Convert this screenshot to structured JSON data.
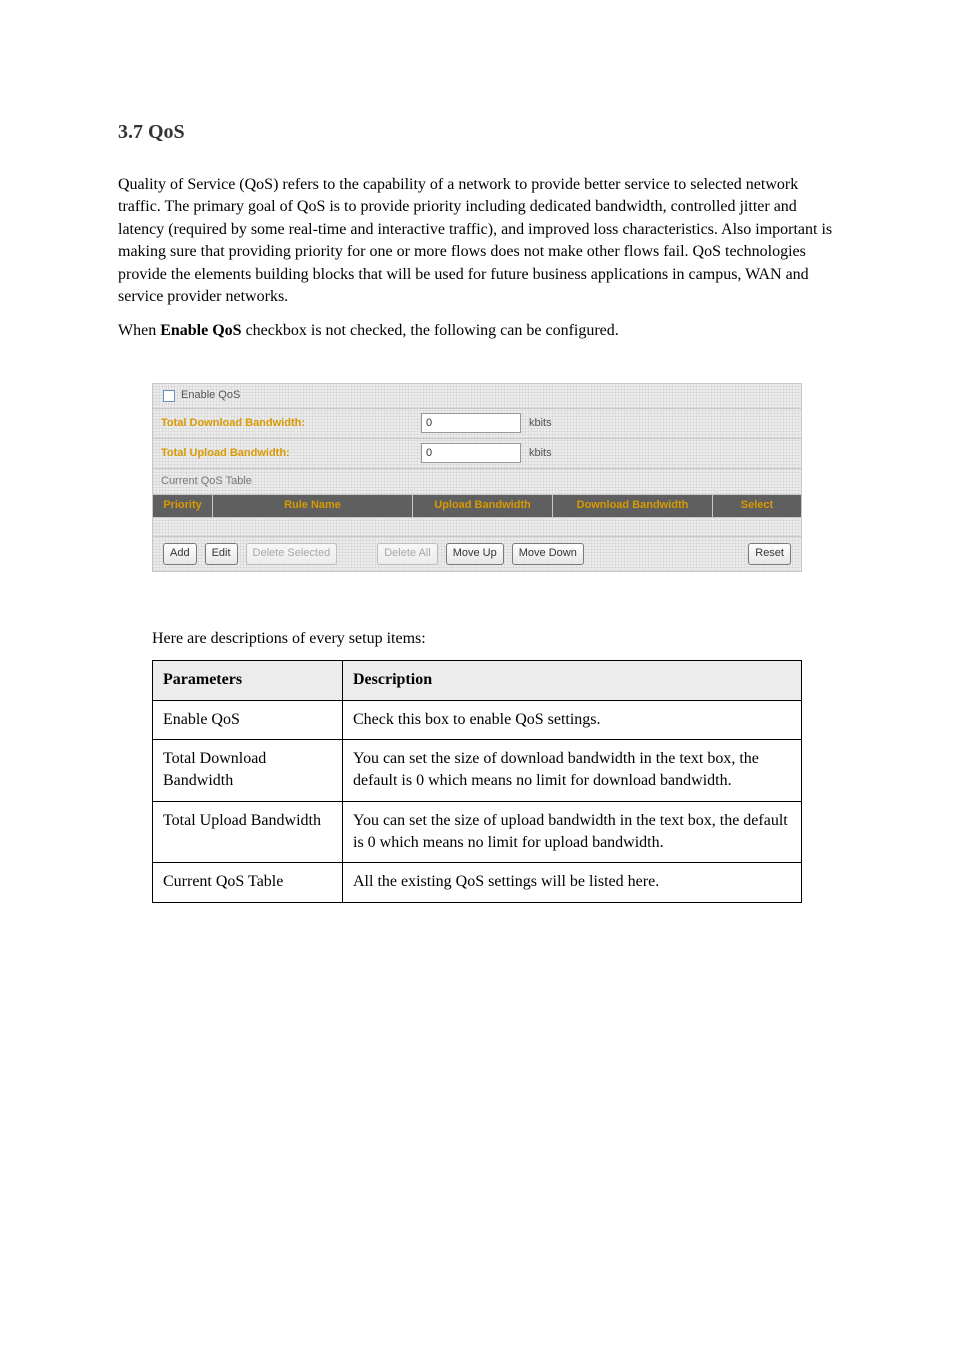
{
  "intro": {
    "title": "3.7 QoS",
    "paragraphs": [
      {
        "prefix": "Quality of Service (QoS) refers to the capability of a network to provide better service to selected network traffic.  The primary goal of QoS is to provide priority including dedicated bandwidth, controlled jitter and latency (required by some real-time and interactive traffic), and improved loss characteristics.  Also important is making sure that providing priority for one or more flows does not make other flows fail. QoS technologies provide the elements building blocks that will be used for future business applications in campus, WAN and service provider networks."
      },
      {
        "prefix": "When ",
        "bold": "Enable QoS",
        "suffix": " checkbox is not checked, the following can be configured."
      }
    ]
  },
  "panel": {
    "enable_label": "Enable QoS",
    "download": {
      "label": "Total Download Bandwidth:",
      "value": "0",
      "unit": "kbits"
    },
    "upload": {
      "label": "Total Upload Bandwidth:",
      "value": "0",
      "unit": "kbits"
    },
    "table_caption": "Current QoS Table",
    "headers": {
      "priority": "Priority",
      "rule": "Rule Name",
      "upload": "Upload Bandwidth",
      "download": "Download Bandwidth",
      "select": "Select"
    },
    "buttons": {
      "add": "Add",
      "edit": "Edit",
      "delete_selected": "Delete Selected",
      "delete_all": "Delete All",
      "move_up": "Move Up",
      "move_down": "Move Down",
      "reset": "Reset"
    }
  },
  "desc": {
    "heading": "Here are descriptions of every setup items:",
    "columns": {
      "param": "Parameters",
      "desc": "Description"
    },
    "rows": [
      {
        "param": "Enable QoS",
        "desc": "Check this box to enable QoS settings."
      },
      {
        "param": "Total Download Bandwidth",
        "desc": "You can set the size of download bandwidth in the text box, the default is 0 which means no limit for download bandwidth."
      },
      {
        "param": "Total Upload Bandwidth",
        "desc": "You can set the size of upload bandwidth in the text box, the default is 0 which means no limit for upload bandwidth."
      },
      {
        "param": "Current QoS Table",
        "desc": "All the existing QoS settings will be listed here."
      }
    ]
  }
}
